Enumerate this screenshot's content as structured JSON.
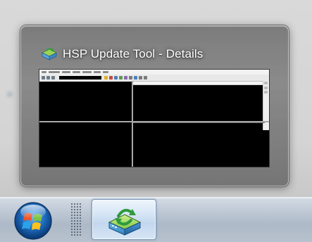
{
  "thumbnail": {
    "title": "HSP Update Tool - Details",
    "icon": "hsp-update-tool-icon"
  },
  "taskbar": {
    "start_button_icon": "windows-start-orb-icon",
    "grip_icon": "taskbar-grip-icon",
    "task_button_icon": "hsp-update-tool-icon"
  },
  "colors": {
    "popup_background": "#7a7a7a",
    "preview_background": "#000000",
    "taskbar_background": "#b8c2cf",
    "task_button_highlight": "#d7e6f6"
  }
}
